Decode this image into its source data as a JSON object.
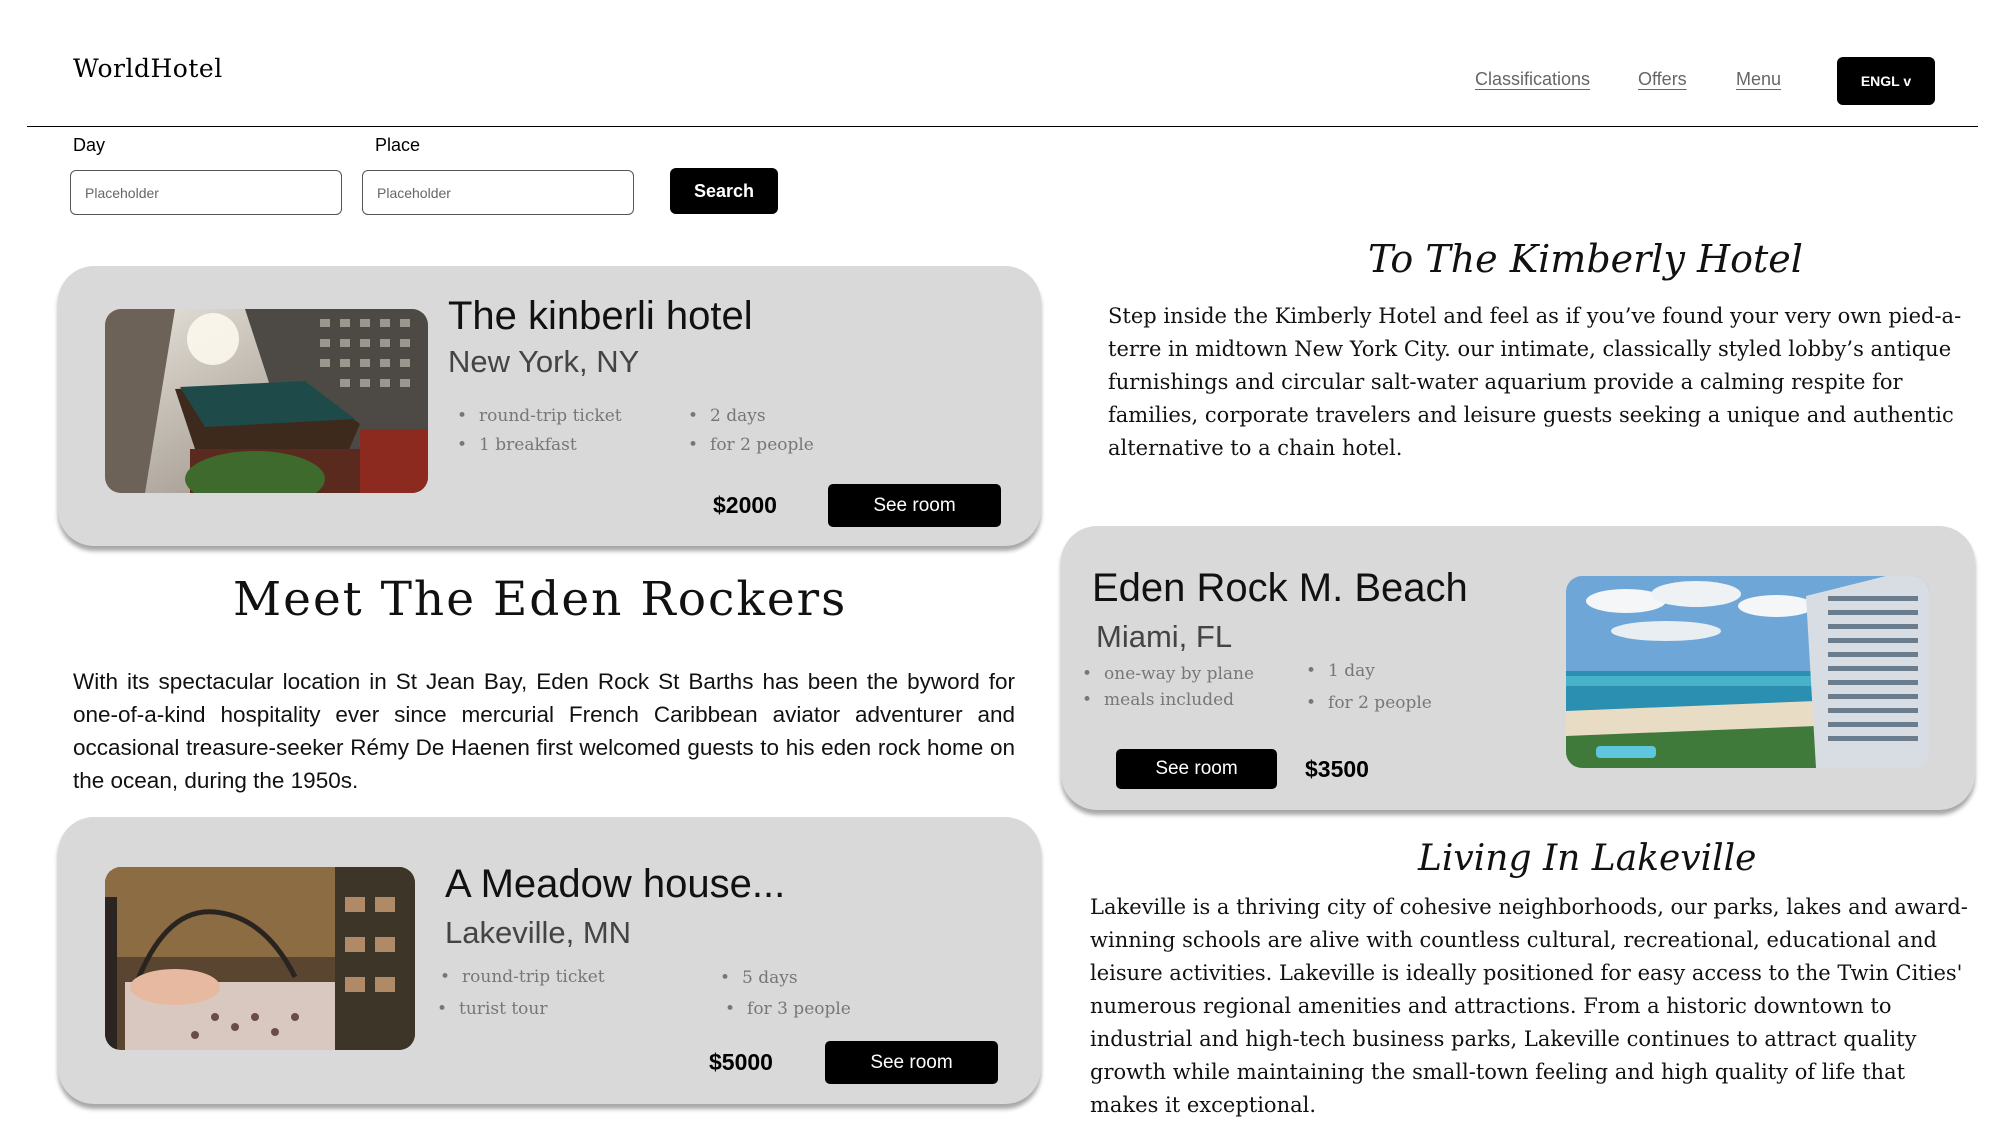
{
  "header": {
    "logo": "WorldHotel",
    "nav": [
      "Classifications",
      "Offers",
      "Menu"
    ],
    "language_button": "ENGL ᴠ"
  },
  "search": {
    "day_label": "Day",
    "day_placeholder": "Placeholder",
    "place_label": "Place",
    "place_placeholder": "Placeholder",
    "button_label": "Search"
  },
  "hotels": [
    {
      "title": "The kinberli hotel",
      "location": "New York, NY",
      "features_left": [
        "round-trip ticket",
        "1 breakfast"
      ],
      "features_right": [
        "2 days",
        "for 2 people"
      ],
      "price": "$2000",
      "button": "See room"
    },
    {
      "title": "Eden Rock M. Beach",
      "location": "Miami, FL",
      "features_left": [
        "one-way by plane",
        "meals included"
      ],
      "features_right": [
        "1 day",
        "for 2 people"
      ],
      "price": "$3500",
      "button": "See room"
    },
    {
      "title": "A Meadow house...",
      "location": "Lakeville, MN",
      "features_left": [
        "round-trip ticket",
        "turist tour"
      ],
      "features_right": [
        "5 days",
        "for 3 people"
      ],
      "price": "$5000",
      "button": "See room"
    }
  ],
  "kimberly_section": {
    "title": "To The Kimberly Hotel",
    "text": "Step inside the Kimberly Hotel and feel as if you’ve found your very own pied-a-terre in midtown New York City. our intimate, classically styled lobby’s antique furnishings and circular salt-water aquarium provide a calming respite for families, corporate travelers and leisure guests seeking a unique and authentic alternative to a chain hotel."
  },
  "eden_section": {
    "title": "Meet The Eden Rockers",
    "text": "With its spectacular location in St Jean Bay, Eden Rock St Barths has been the byword for one-of-a-kind hospitality ever since mercurial French Caribbean aviator adventurer and occasional treasure-seeker Rémy De Haenen first welcomed guests to his eden rock home on the ocean, during the 1950s."
  },
  "lakeville_section": {
    "title": "Living In Lakeville",
    "text": "Lakeville is a thriving city of cohesive neighborhoods, our parks, lakes and award-winning schools are alive with countless cultural, recreational, educational and leisure activities. Lakeville is ideally positioned for easy access to the Twin Cities' numerous regional amenities and attractions. From a historic downtown to industrial and high-tech business parks, Lakeville continues to attract quality growth while maintaining the small-town feeling and high quality of life that makes it exceptional."
  }
}
